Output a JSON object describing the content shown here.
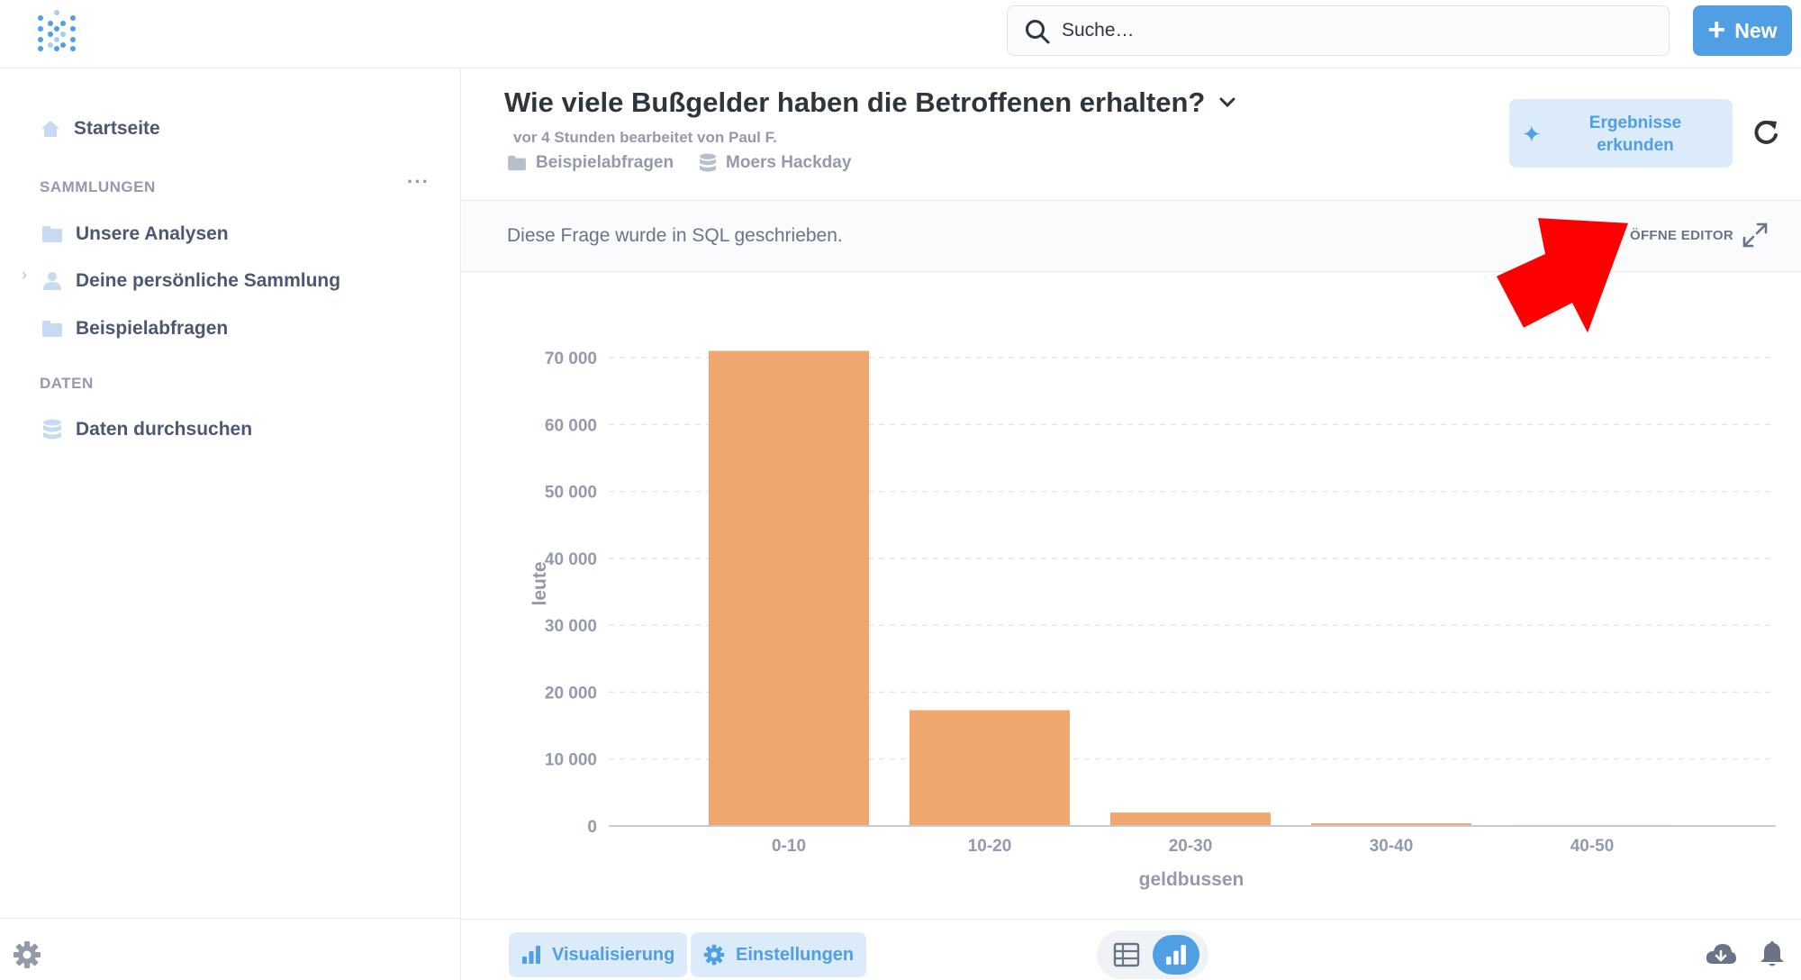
{
  "search": {
    "placeholder": "Suche…"
  },
  "new_button": {
    "label": "New"
  },
  "sidebar": {
    "home_label": "Startseite",
    "collections_header": "SAMMLUNGEN",
    "collections": [
      {
        "label": "Unsere Analysen",
        "icon": "folder-icon"
      },
      {
        "label": "Deine persönliche Sammlung",
        "icon": "person-icon"
      },
      {
        "label": "Beispielabfragen",
        "icon": "folder-icon"
      }
    ],
    "data_header": "DATEN",
    "browse_data_label": "Daten durchsuchen"
  },
  "question": {
    "title": "Wie viele Bußgelder haben die Betroffenen erhalten?",
    "edited": "vor 4 Stunden bearbeitet von Paul F.",
    "collection": "Beispielabfragen",
    "database": "Moers Hackday",
    "explore_label_line1": "Ergebnisse",
    "explore_label_line2": "erkunden"
  },
  "sql_banner": {
    "text": "Diese Frage wurde in SQL geschrieben.",
    "open_editor": "ÖFFNE EDITOR"
  },
  "bottom": {
    "visualization_label": "Visualisierung",
    "settings_label": "Einstellungen"
  },
  "colors": {
    "accent": "#509ee3",
    "bar": "#f0a76e",
    "annotation_arrow": "#ff0000"
  },
  "chart_data": {
    "type": "bar",
    "categories": [
      "0-10",
      "10-20",
      "20-30",
      "30-40",
      "40-50"
    ],
    "values": [
      71000,
      17300,
      2000,
      400,
      150
    ],
    "xlabel": "geldbussen",
    "ylabel": "leute",
    "ylim": [
      0,
      70000
    ],
    "yticks": [
      0,
      10000,
      20000,
      30000,
      40000,
      50000,
      60000,
      70000
    ],
    "ytick_labels": [
      "0",
      "10 000",
      "20 000",
      "30 000",
      "40 000",
      "50 000",
      "60 000",
      "70 000"
    ],
    "grid": true
  }
}
